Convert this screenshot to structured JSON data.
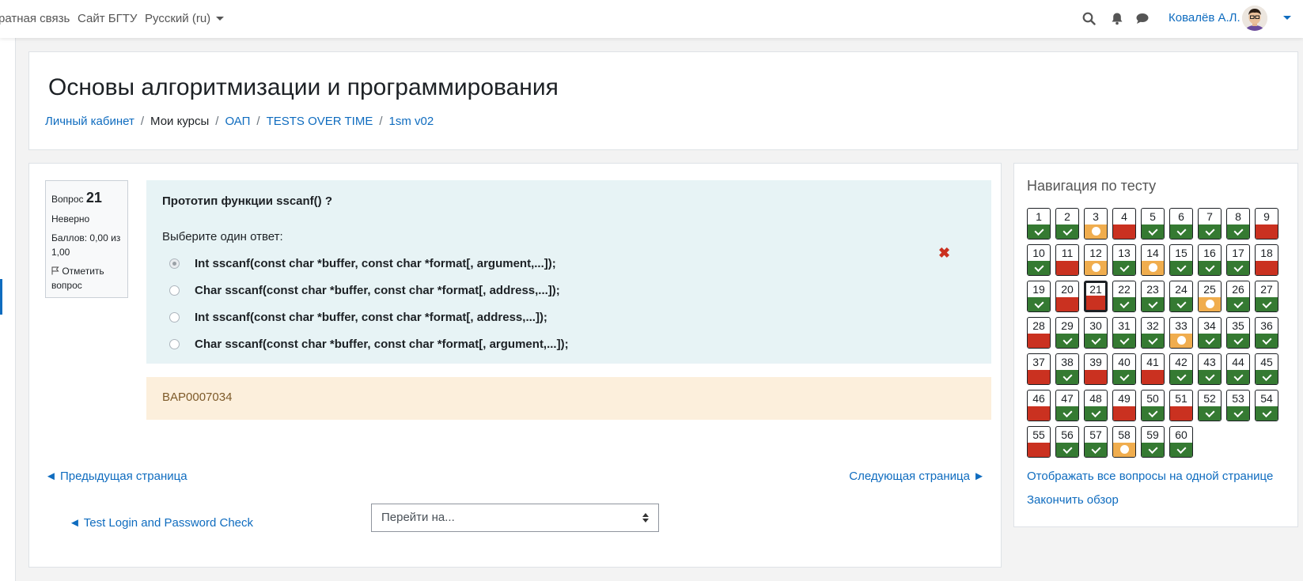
{
  "navbar": {
    "feedback": "ратная связь",
    "site": "Сайт БГТУ",
    "language": "Русский (ru)",
    "user_name": "Ковалёв А.Л."
  },
  "header": {
    "title": "Основы алгоритмизации и программирования",
    "breadcrumb": [
      "Личный кабинет",
      "Мои курсы",
      "ОАП",
      "TESTS OVER TIME",
      "1sm v02"
    ]
  },
  "info": {
    "question_label": "Вопрос",
    "question_number": "21",
    "state": "Неверно",
    "grade": "Баллов: 0,00 из 1,00",
    "flag": "Отметить вопрос"
  },
  "question": {
    "text": "Прототип функции sscanf() ?",
    "prompt": "Выберите один ответ:",
    "options": [
      {
        "text": "Int sscanf(const char *buffer, const char *format[, argument,...]);",
        "checked": true
      },
      {
        "text": "Char sscanf(const char *buffer, const char *format[, address,...]);",
        "checked": false
      },
      {
        "text": "Int sscanf(const char *buffer, const char *format[, address,...]);",
        "checked": false
      },
      {
        "text": "Char sscanf(const char *buffer, const char *format[, argument,...]);",
        "checked": false
      }
    ],
    "wrong_mark": "✖",
    "feedback": "BAP0007034"
  },
  "paging": {
    "prev": "◄ Предыдущая страница",
    "next": "Следующая страница ►",
    "activity_link": "◄ Test Login and Password Check",
    "jump_placeholder": "Перейти на..."
  },
  "quiz_nav": {
    "title": "Навигация по тесту",
    "current": 21,
    "states": [
      "correct",
      "correct",
      "partial",
      "incorrect",
      "correct",
      "correct",
      "correct",
      "correct",
      "incorrect",
      "correct",
      "incorrect",
      "partial",
      "correct",
      "partial",
      "correct",
      "correct",
      "correct",
      "incorrect",
      "correct",
      "incorrect",
      "incorrect",
      "correct",
      "correct",
      "correct",
      "partial",
      "correct",
      "correct",
      "incorrect",
      "correct",
      "correct",
      "correct",
      "correct",
      "partial",
      "correct",
      "correct",
      "correct",
      "incorrect",
      "correct",
      "incorrect",
      "correct",
      "incorrect",
      "correct",
      "correct",
      "correct",
      "correct",
      "incorrect",
      "correct",
      "correct",
      "incorrect",
      "correct",
      "incorrect",
      "correct",
      "correct",
      "correct",
      "incorrect",
      "correct",
      "correct",
      "partial",
      "correct",
      "correct"
    ],
    "show_all": "Отображать все вопросы на одной странице",
    "finish": "Закончить обзор"
  },
  "colors": {
    "link": "#0f6cbf",
    "correct": "#357a32",
    "incorrect": "#ca3120",
    "partial": "#f0ad4e",
    "question_bg": "#e7f3f5",
    "feedback_bg": "#fcefdc"
  }
}
